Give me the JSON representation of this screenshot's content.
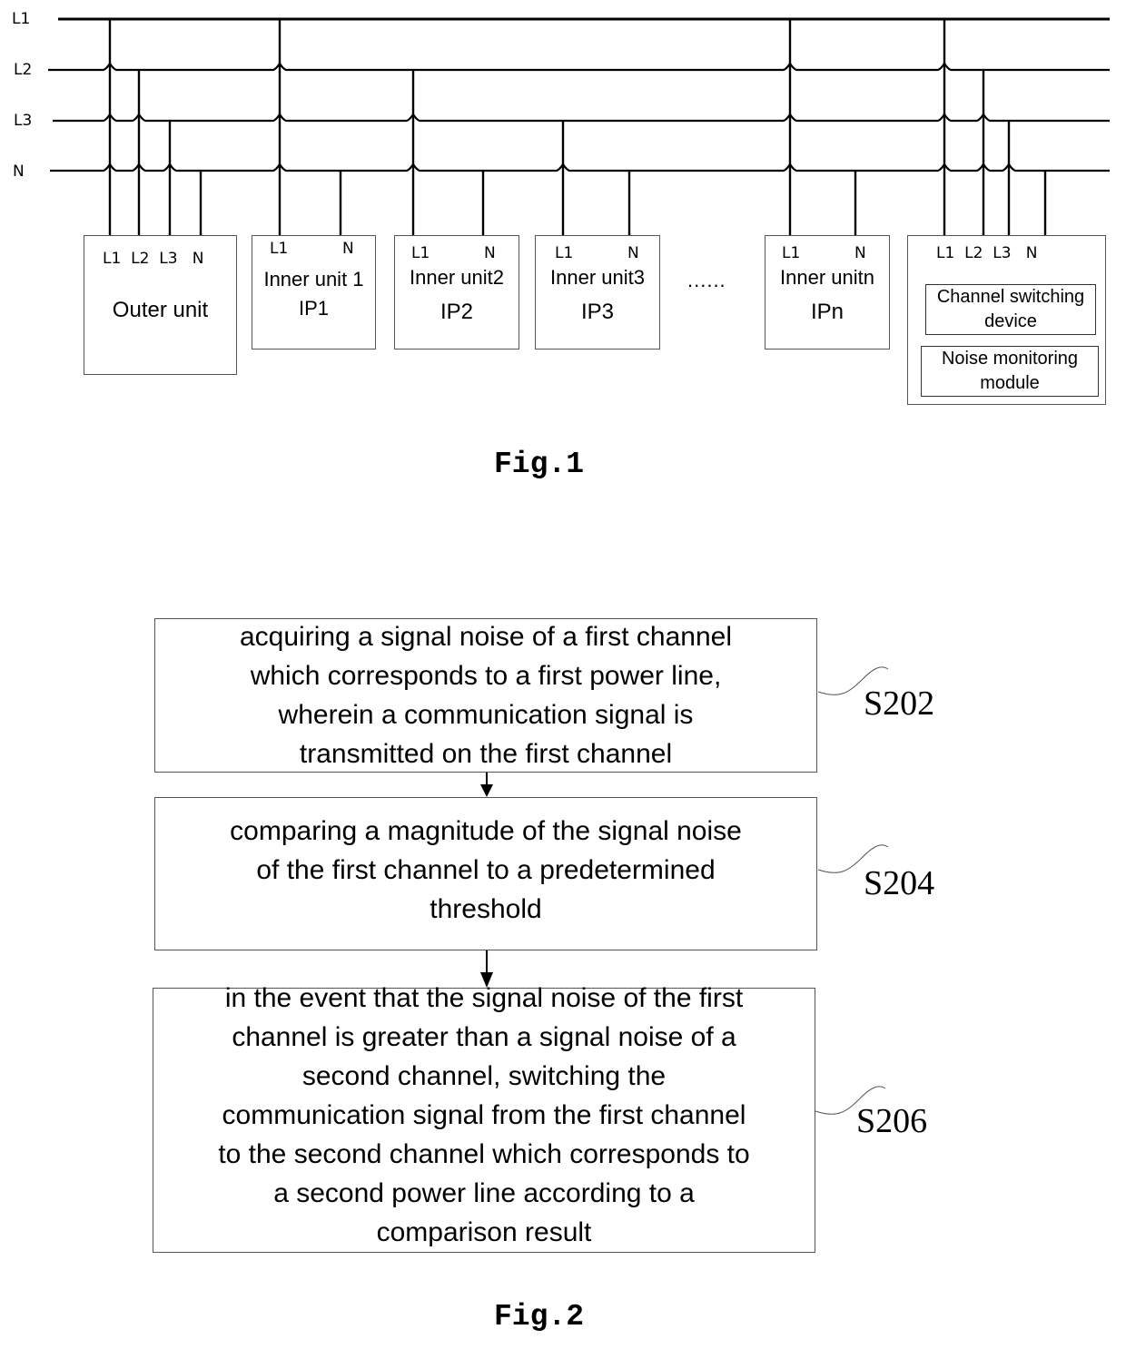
{
  "fig1": {
    "caption": "Fig.1",
    "bus_lines": [
      "L1",
      "L2",
      "L3",
      "N"
    ],
    "units": [
      {
        "id": "outer",
        "pins": [
          "L1",
          "L2",
          "L3",
          "N"
        ],
        "title": "Outer unit",
        "subtitle": ""
      },
      {
        "id": "inner1",
        "pins": [
          "L1",
          "N"
        ],
        "title": "Inner unit 1",
        "subtitle": "IP1"
      },
      {
        "id": "inner2",
        "pins": [
          "L1",
          "N"
        ],
        "title": "Inner unit2",
        "subtitle": "IP2"
      },
      {
        "id": "inner3",
        "pins": [
          "L1",
          "N"
        ],
        "title": "Inner unit3",
        "subtitle": "IP3"
      },
      {
        "id": "innern",
        "pins": [
          "L1",
          "N"
        ],
        "title": "Inner unitn",
        "subtitle": "IPn"
      },
      {
        "id": "controller",
        "pins": [
          "L1",
          "L2",
          "L3",
          "N"
        ],
        "modules": [
          "Channel switching device",
          "Noise monitoring module"
        ]
      }
    ],
    "ellipsis": "......",
    "connections": [
      {
        "unit": "outer",
        "lines": [
          "L1",
          "L2",
          "L3",
          "N"
        ]
      },
      {
        "unit": "inner1",
        "lines": [
          "L1",
          "N"
        ]
      },
      {
        "unit": "inner2",
        "lines": [
          "L2",
          "N"
        ]
      },
      {
        "unit": "inner3",
        "lines": [
          "L3",
          "N"
        ]
      },
      {
        "unit": "innern",
        "lines": [
          "L1",
          "N"
        ]
      },
      {
        "unit": "controller",
        "lines": [
          "L1",
          "L2",
          "L3",
          "N"
        ]
      }
    ]
  },
  "fig2": {
    "caption": "Fig.2",
    "steps": [
      {
        "label": "S202",
        "lines": [
          "acquiring a signal noise of a first channel",
          "which corresponds to a first power line,",
          "wherein a communication signal is",
          "transmitted on the first channel"
        ]
      },
      {
        "label": "S204",
        "lines": [
          "comparing a magnitude of the signal noise",
          "of the first channel to a predetermined",
          "threshold"
        ]
      },
      {
        "label": "S206",
        "lines": [
          "in the event that the signal noise of the first",
          "channel is greater than a signal noise of a",
          "second channel, switching the",
          "communication signal from the first channel",
          "to the second channel which corresponds to",
          "a second power line according to a",
          "comparison result"
        ]
      }
    ]
  }
}
